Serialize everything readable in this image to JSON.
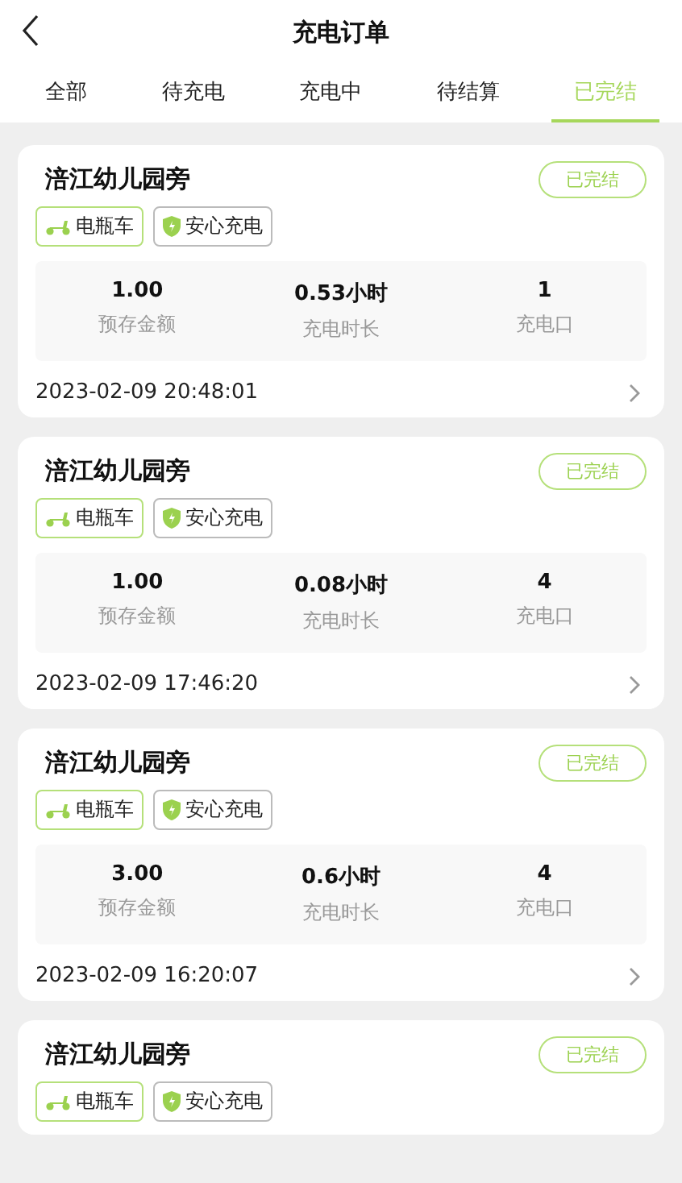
{
  "header": {
    "title": "充电订单"
  },
  "tabs": [
    {
      "label": "全部",
      "selected": false
    },
    {
      "label": "待充电",
      "selected": false
    },
    {
      "label": "充电中",
      "selected": false
    },
    {
      "label": "待结算",
      "selected": false
    },
    {
      "label": "已完结",
      "selected": true
    }
  ],
  "orders": [
    {
      "station": "涪江幼儿园旁",
      "status": "已完结",
      "tags": [
        {
          "kind": "vehicle",
          "label": "电瓶车"
        },
        {
          "kind": "safe",
          "label": "安心充电"
        }
      ],
      "stats": [
        {
          "value": "1.00",
          "label": "预存金额"
        },
        {
          "value": "0.53小时",
          "label": "充电时长"
        },
        {
          "value": "1",
          "label": "充电口"
        }
      ],
      "time": "2023-02-09 20:48:01"
    },
    {
      "station": "涪江幼儿园旁",
      "status": "已完结",
      "tags": [
        {
          "kind": "vehicle",
          "label": "电瓶车"
        },
        {
          "kind": "safe",
          "label": "安心充电"
        }
      ],
      "stats": [
        {
          "value": "1.00",
          "label": "预存金额"
        },
        {
          "value": "0.08小时",
          "label": "充电时长"
        },
        {
          "value": "4",
          "label": "充电口"
        }
      ],
      "time": "2023-02-09 17:46:20"
    },
    {
      "station": "涪江幼儿园旁",
      "status": "已完结",
      "tags": [
        {
          "kind": "vehicle",
          "label": "电瓶车"
        },
        {
          "kind": "safe",
          "label": "安心充电"
        }
      ],
      "stats": [
        {
          "value": "3.00",
          "label": "预存金额"
        },
        {
          "value": "0.6小时",
          "label": "充电时长"
        },
        {
          "value": "4",
          "label": "充电口"
        }
      ],
      "time": "2023-02-09 16:20:07"
    },
    {
      "station": "涪江幼儿园旁",
      "status": "已完结",
      "tags": [
        {
          "kind": "vehicle",
          "label": "电瓶车"
        },
        {
          "kind": "safe",
          "label": "安心充电"
        }
      ]
    }
  ]
}
